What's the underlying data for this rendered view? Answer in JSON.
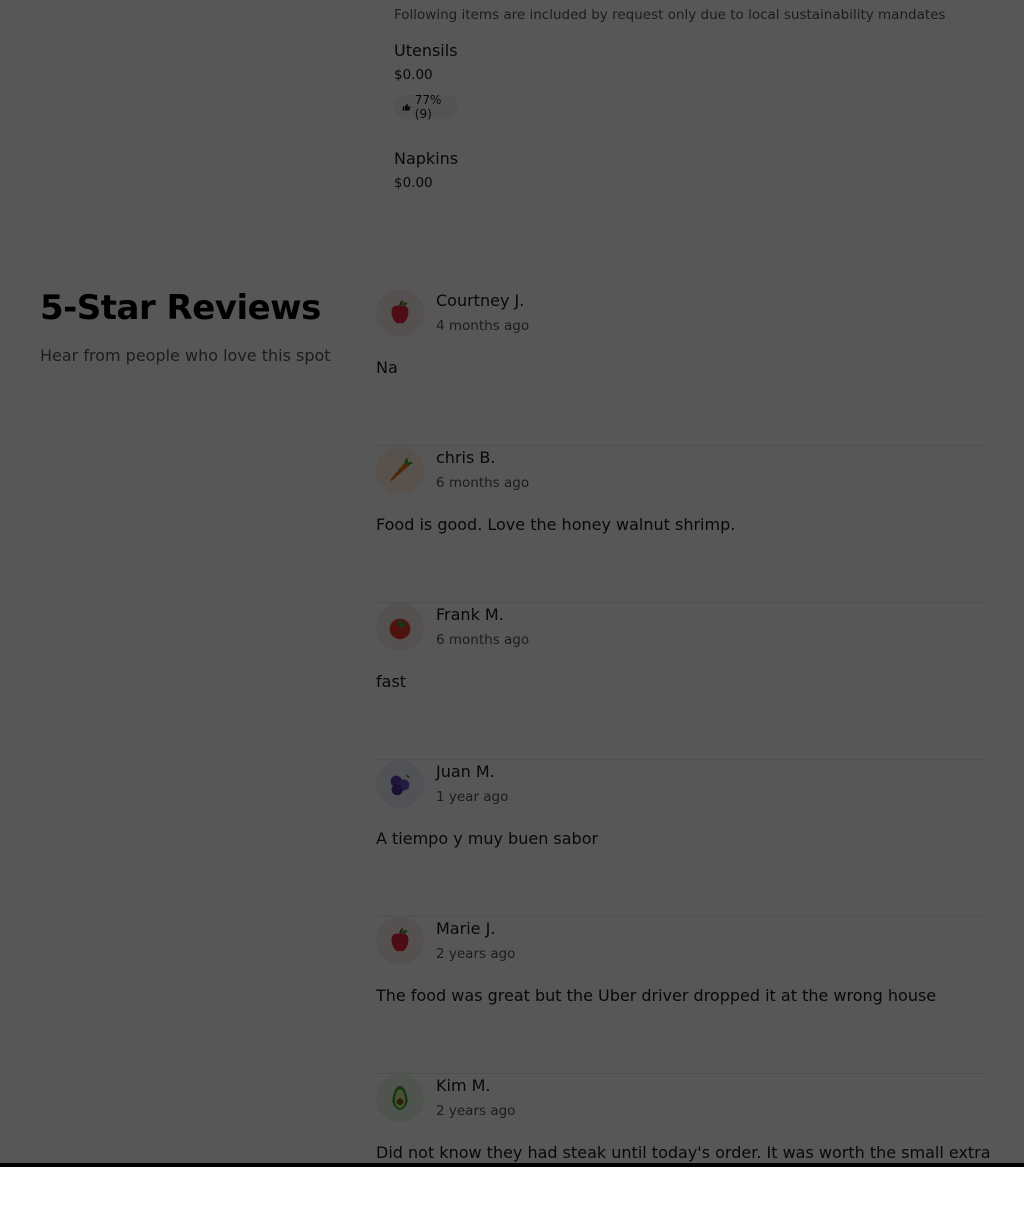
{
  "requested_items": {
    "note": "Following items are included by request only due to local sustainability mandates",
    "items": [
      {
        "name": "Utensils",
        "price": "$0.00",
        "rating": "77% (9)"
      },
      {
        "name": "Napkins",
        "price": "$0.00"
      }
    ]
  },
  "reviews_section": {
    "title": "5-Star Reviews",
    "subtitle": "Hear from people who love this spot",
    "reviews": [
      {
        "name": "Courtney J.",
        "date": "4 months ago",
        "text": "Na",
        "avatar_icon": "apple-icon"
      },
      {
        "name": "chris B.",
        "date": "6 months ago",
        "text": "Food is good. Love the honey walnut shrimp.",
        "avatar_icon": "carrot-icon"
      },
      {
        "name": "Frank M.",
        "date": "6 months ago",
        "text": "fast",
        "avatar_icon": "tomato-icon"
      },
      {
        "name": "Juan M.",
        "date": "1 year ago",
        "text": "A tiempo y muy buen sabor",
        "avatar_icon": "blueberries-icon"
      },
      {
        "name": "Marie J.",
        "date": "2 years ago",
        "text": "The food was great but the Uber driver dropped it at the wrong house",
        "avatar_icon": "apple-icon"
      },
      {
        "name": "Kim M.",
        "date": "2 years ago",
        "text": "Did not know they had steak until today's order. It was worth the small extra",
        "avatar_icon": "avocado-icon"
      }
    ]
  },
  "colors": {
    "overlay": "#000000A8",
    "avatar_apple_bg": "#FDECEC",
    "avatar_carrot_bg": "#FFF0E2",
    "avatar_tomato_bg": "#FDECEC",
    "avatar_blueberries_bg": "#EEF0FB",
    "avatar_avocado_bg": "#E7F6E4"
  }
}
